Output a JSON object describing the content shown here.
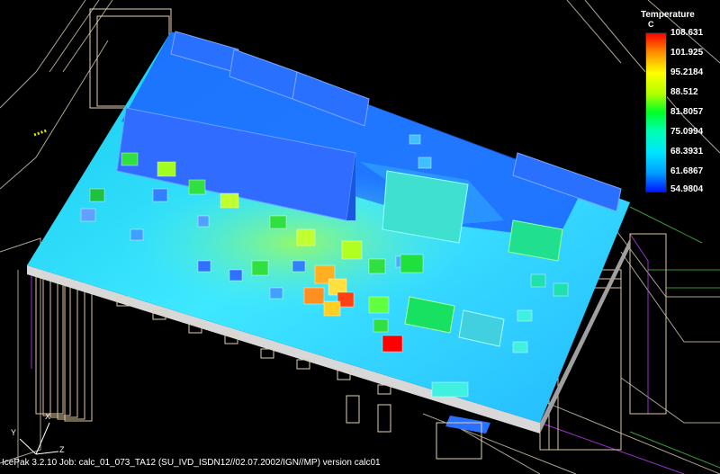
{
  "legend": {
    "title": "Temperature",
    "unit": "C",
    "ticks": [
      "108.631",
      "101.925",
      "95.2184",
      "88.512",
      "81.8057",
      "75.0994",
      "68.3931",
      "61.6867",
      "54.9804"
    ],
    "colors": [
      "#ff0000",
      "#ff8c00",
      "#ffff00",
      "#b4ff00",
      "#00ff28",
      "#00ffb4",
      "#00e6ff",
      "#00a0ff",
      "#0018ff"
    ]
  },
  "status_bar": {
    "text": "IcePak 3.2.10 Job: calc_01_073_TA12 (SU_IVD_ISDN12//02.07.2002/IGN//MP) version calc01"
  },
  "axis_triad": {
    "x": "X",
    "y": "Y",
    "z": "Z"
  }
}
